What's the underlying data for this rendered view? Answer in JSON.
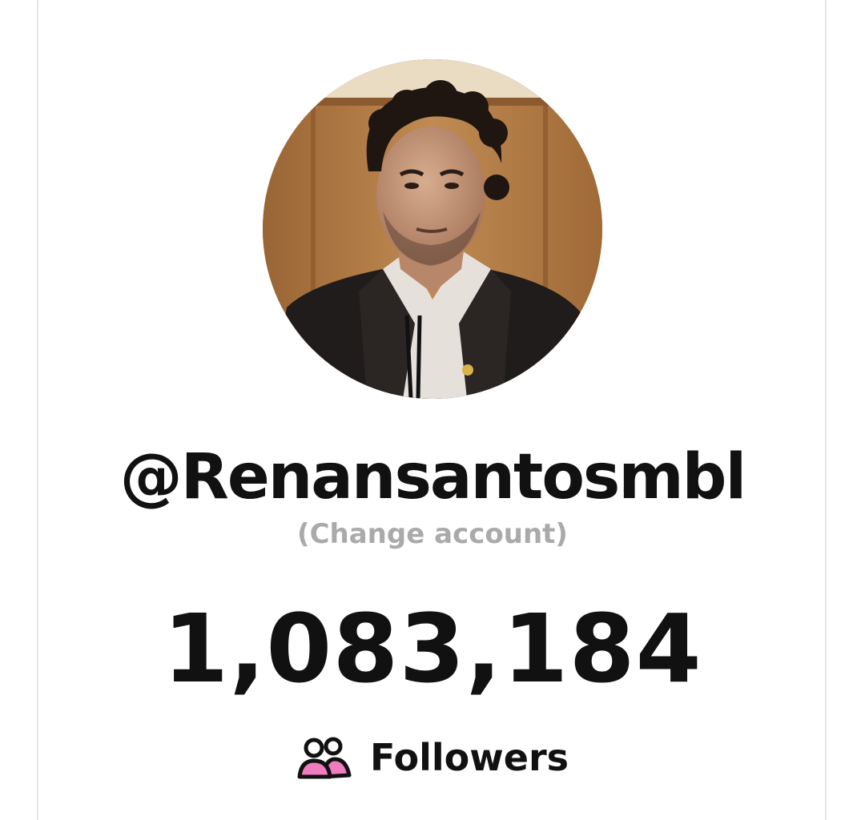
{
  "profile": {
    "handle": "@Renansantosmbl",
    "change_account_label": "(Change account)",
    "follower_count": "1,083,184",
    "followers_label": "Followers",
    "followers_icon": "users-icon",
    "avatar": "profile-photo"
  },
  "colors": {
    "text_primary": "#111111",
    "text_muted": "#aaaaaa",
    "icon_accent": "#f07cc0",
    "card_border": "#e6e6e6"
  }
}
